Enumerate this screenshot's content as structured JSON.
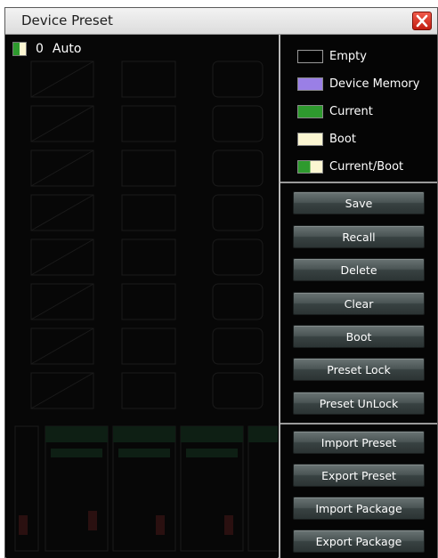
{
  "window": {
    "title": "Device Preset"
  },
  "preset_list": {
    "items": [
      {
        "number": "0",
        "name": "Auto",
        "state": "Current/Boot"
      }
    ]
  },
  "legend": {
    "items": [
      {
        "label": "Empty",
        "color": "#000000"
      },
      {
        "label": "Device Memory",
        "color": "#9a7fe6"
      },
      {
        "label": "Current",
        "color": "#2e9a2e"
      },
      {
        "label": "Boot",
        "color": "#fbf6d2"
      },
      {
        "label": "Current/Boot",
        "colors": [
          "#2e9a2e",
          "#fbf6d2"
        ]
      }
    ]
  },
  "actions": {
    "save": "Save",
    "recall": "Recall",
    "delete": "Delete",
    "clear": "Clear",
    "boot": "Boot",
    "preset_lock": "Preset Lock",
    "preset_unlock": "Preset UnLock"
  },
  "file_actions": {
    "import_preset": "Import Preset",
    "export_preset": "Export Preset",
    "import_package": "Import Package",
    "export_package": "Export Package"
  }
}
